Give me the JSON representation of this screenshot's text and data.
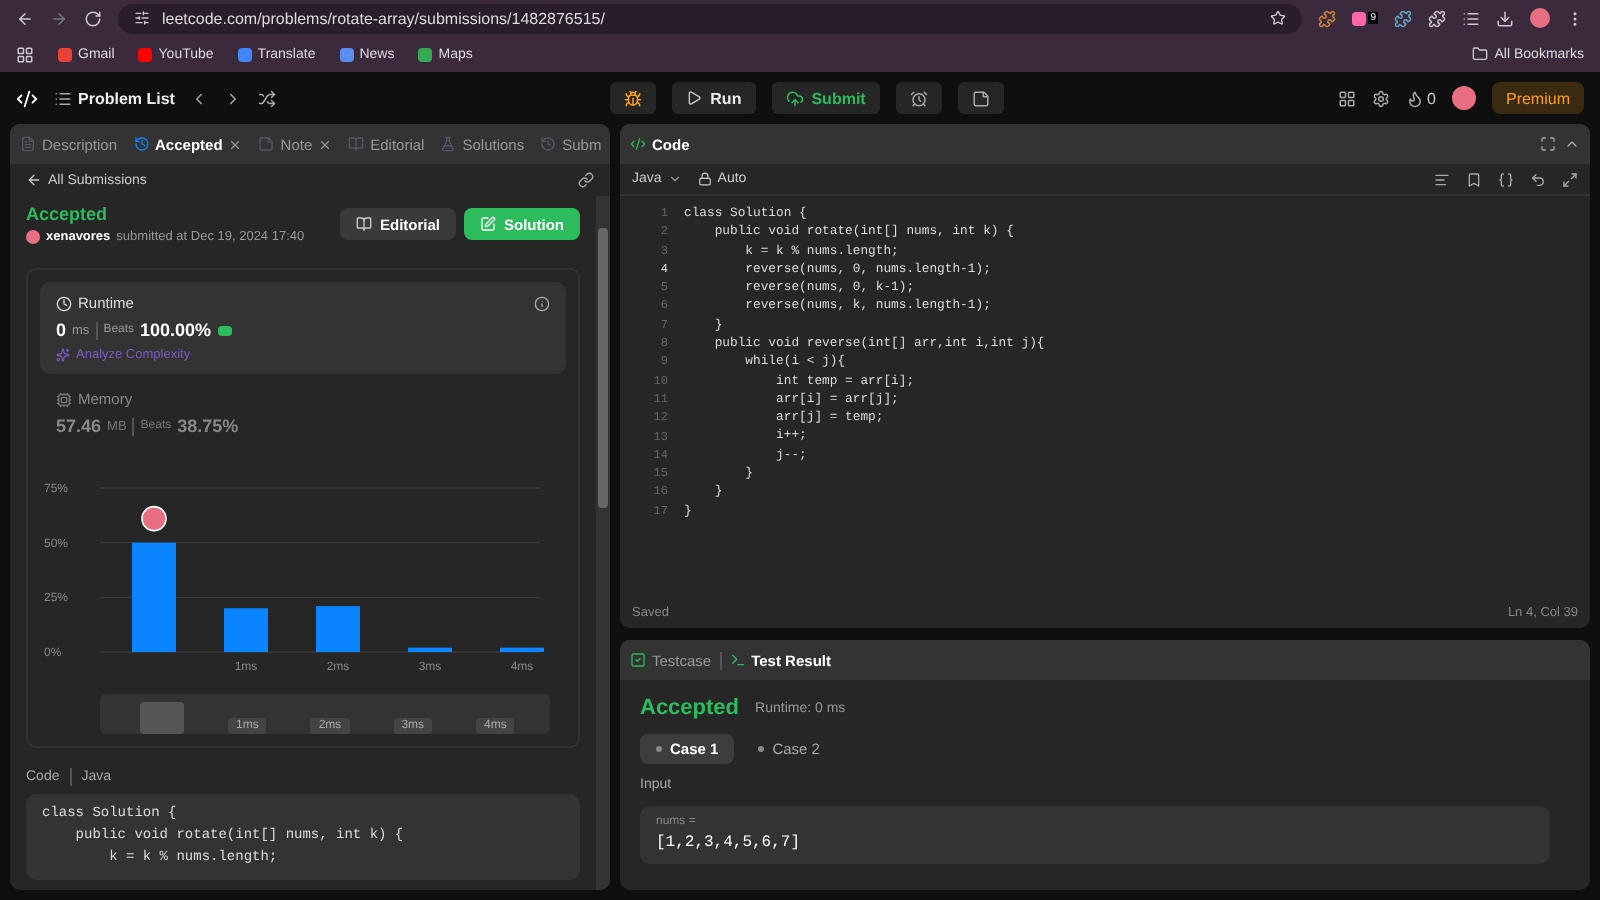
{
  "browser": {
    "url": "leetcode.com/problems/rotate-array/submissions/1482876515/",
    "extension_badge": "9",
    "bookmarks": [
      {
        "label": "Gmail"
      },
      {
        "label": "YouTube"
      },
      {
        "label": "Translate"
      },
      {
        "label": "News"
      },
      {
        "label": "Maps"
      }
    ],
    "all_bookmarks": "All Bookmarks"
  },
  "nav": {
    "problem_list": "Problem List",
    "run": "Run",
    "submit": "Submit",
    "streak": "0",
    "premium": "Premium"
  },
  "left_tabs": [
    {
      "label": "Description",
      "selected": false,
      "closable": false
    },
    {
      "label": "Accepted",
      "selected": true,
      "closable": true
    },
    {
      "label": "Note",
      "selected": false,
      "closable": true
    },
    {
      "label": "Editorial",
      "selected": false,
      "closable": false
    },
    {
      "label": "Solutions",
      "selected": false,
      "closable": false
    },
    {
      "label": "Subm",
      "selected": false,
      "closable": false
    }
  ],
  "back_link": "All Submissions",
  "submission": {
    "status": "Accepted",
    "user": "xenavores",
    "submitted": "submitted at Dec 19, 2024 17:40",
    "editorial_button": "Editorial",
    "solution_button": "Solution"
  },
  "runtime": {
    "title": "Runtime",
    "value": "0",
    "unit": "ms",
    "beats_label": "Beats",
    "beats": "100.00%",
    "analyze": "Analyze Complexity"
  },
  "memory": {
    "title": "Memory",
    "value": "57.46",
    "unit": "MB",
    "beats_label": "Beats",
    "beats": "38.75%"
  },
  "chart_data": {
    "type": "bar",
    "categories": [
      null,
      "1ms",
      "2ms",
      "3ms",
      "4ms"
    ],
    "values": [
      50,
      20,
      21,
      2,
      2
    ],
    "ylim": [
      0,
      75
    ],
    "yticks": [
      {
        "value": 0,
        "label": "0%"
      },
      {
        "value": 25,
        "label": "25%"
      },
      {
        "value": 50,
        "label": "50%"
      },
      {
        "value": 75,
        "label": "75%"
      }
    ]
  },
  "navigator_labels": [
    "1ms",
    "2ms",
    "3ms",
    "4ms"
  ],
  "snippet": {
    "label": "Code",
    "language": "Java",
    "lines": [
      "class Solution {",
      "    public void rotate(int[] nums, int k) {",
      "        k = k % nums.length;"
    ]
  },
  "editor": {
    "title": "Code",
    "language": "Java",
    "mode": "Auto",
    "status": "Saved",
    "cursor": "Ln 4, Col 39",
    "lines": [
      {
        "no": "1",
        "text": "class Solution {",
        "current": false
      },
      {
        "no": "2",
        "text": "    public void rotate(int[] nums, int k) {",
        "current": false
      },
      {
        "no": "3",
        "text": "        k = k % nums.length;",
        "current": false
      },
      {
        "no": "4",
        "text": "        reverse(nums, 0, nums.length-1);",
        "current": true
      },
      {
        "no": "5",
        "text": "        reverse(nums, 0, k-1);",
        "current": false
      },
      {
        "no": "6",
        "text": "        reverse(nums, k, nums.length-1);",
        "current": false
      },
      {
        "no": "7",
        "text": "    }",
        "current": false
      },
      {
        "no": "8",
        "text": "    public void reverse(int[] arr,int i,int j){",
        "current": false
      },
      {
        "no": "9",
        "text": "        while(i < j){",
        "current": false
      },
      {
        "no": "10",
        "text": "            int temp = arr[i];",
        "current": false
      },
      {
        "no": "11",
        "text": "            arr[i] = arr[j];",
        "current": false
      },
      {
        "no": "12",
        "text": "            arr[j] = temp;",
        "current": false
      },
      {
        "no": "13",
        "text": "            i++;",
        "current": false
      },
      {
        "no": "14",
        "text": "            j--;",
        "current": false
      },
      {
        "no": "15",
        "text": "        }",
        "current": false
      },
      {
        "no": "16",
        "text": "    }",
        "current": false
      },
      {
        "no": "17",
        "text": "}",
        "current": false
      }
    ]
  },
  "test_tabs": [
    {
      "label": "Testcase",
      "selected": false
    },
    {
      "label": "Test Result",
      "selected": true
    }
  ],
  "result": {
    "status": "Accepted",
    "runtime": "Runtime: 0 ms",
    "cases": [
      {
        "label": "Case 1",
        "selected": true
      },
      {
        "label": "Case 2",
        "selected": false
      }
    ],
    "input_label": "Input",
    "param": "nums =",
    "value": "[1,2,3,4,5,6,7]"
  }
}
